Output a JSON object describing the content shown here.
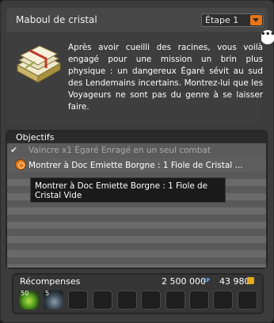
{
  "quest": {
    "title": "Maboul de cristal",
    "step": "Étape 1",
    "description": "Après avoir cueilli des racines, vous voilà engagé pour une mission un brin plus physique : un dangereux Égaré sévit au sud des Lendemains incertains. Montrez-lui que les Voyageurs ne sont pas du genre à se laisser faire."
  },
  "objectives": {
    "title": "Objectifs",
    "items": [
      {
        "text": "Vaincre x1 Égaré Enragé en un seul combat",
        "done": true
      },
      {
        "text": "Montrer à Doc Emiette Borgne : 1 Fiole de Cristal ...",
        "done": false
      }
    ],
    "tooltip": "Montrer à Doc Emiette Borgne : 1 Fiole de Cristal Vide"
  },
  "rewards": {
    "title": "Récompenses",
    "xp": "2 500 000",
    "xp_label": "XP",
    "kamas": "43 980",
    "items": [
      {
        "qty": "50",
        "icon": "green-potion-icon"
      },
      {
        "qty": "5",
        "icon": "dark-creature-icon"
      }
    ]
  }
}
